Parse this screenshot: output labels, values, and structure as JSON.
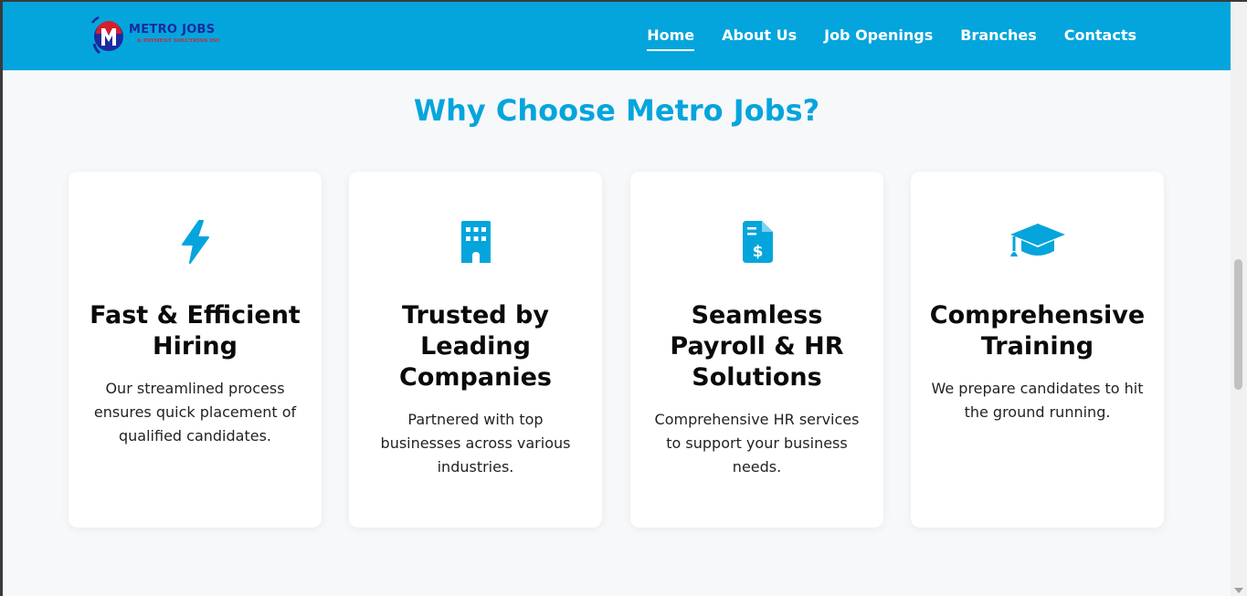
{
  "logo": {
    "badge_letter": "M",
    "title": "METRO JOBS",
    "subtitle": "& PAYMENT SOLUTIONS INC",
    "colors": {
      "blue": "#1b2a9e",
      "red": "#d2202f"
    }
  },
  "nav": {
    "items": [
      {
        "label": "Home",
        "active": true
      },
      {
        "label": "About Us",
        "active": false
      },
      {
        "label": "Job Openings",
        "active": false
      },
      {
        "label": "Branches",
        "active": false
      },
      {
        "label": "Contacts",
        "active": false
      }
    ]
  },
  "section": {
    "title": "Why Choose Metro Jobs?"
  },
  "cards": [
    {
      "icon": "lightning-bolt-icon",
      "title": "Fast & Efficient Hiring",
      "description": "Our streamlined process ensures quick placement of qualified candidates."
    },
    {
      "icon": "building-icon",
      "title": "Trusted by Leading Companies",
      "description": "Partnered with top businesses across various industries."
    },
    {
      "icon": "invoice-dollar-icon",
      "title": "Seamless Payroll & HR Solutions",
      "description": "Comprehensive HR services to support your business needs."
    },
    {
      "icon": "graduation-cap-icon",
      "title": "Comprehensive Training",
      "description": "We prepare candidates to hit the ground running."
    }
  ],
  "colors": {
    "accent": "#04a5dc",
    "background": "#f7f8fa",
    "card": "#ffffff",
    "heading": "#0a0a0a"
  }
}
